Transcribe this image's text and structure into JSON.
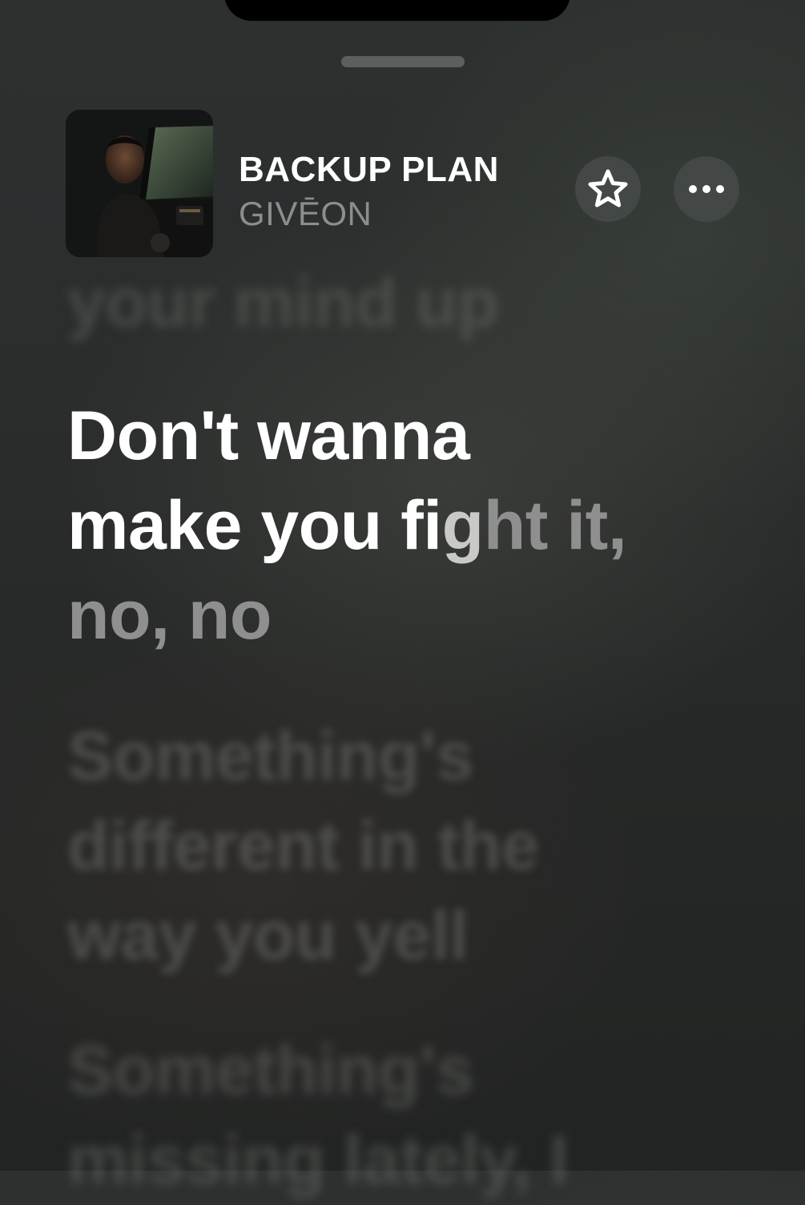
{
  "now_playing": {
    "title": "BACKUP PLAN",
    "artist": "GIVĒON",
    "artwork_icon": "album-artwork",
    "favorite_icon": "star-icon",
    "more_icon": "ellipsis-icon"
  },
  "lyrics": {
    "previous_line": "your mind up",
    "current_line": {
      "line1": "Don't wanna",
      "line2_sung": "make you fi",
      "line2_partial": "g",
      "line2_unsung": "ht it,",
      "line3": "no, no"
    },
    "next_line_1": [
      "Something's",
      "different in the",
      "way you yell"
    ],
    "next_line_2": [
      "Something's",
      "missing lately, I"
    ]
  }
}
